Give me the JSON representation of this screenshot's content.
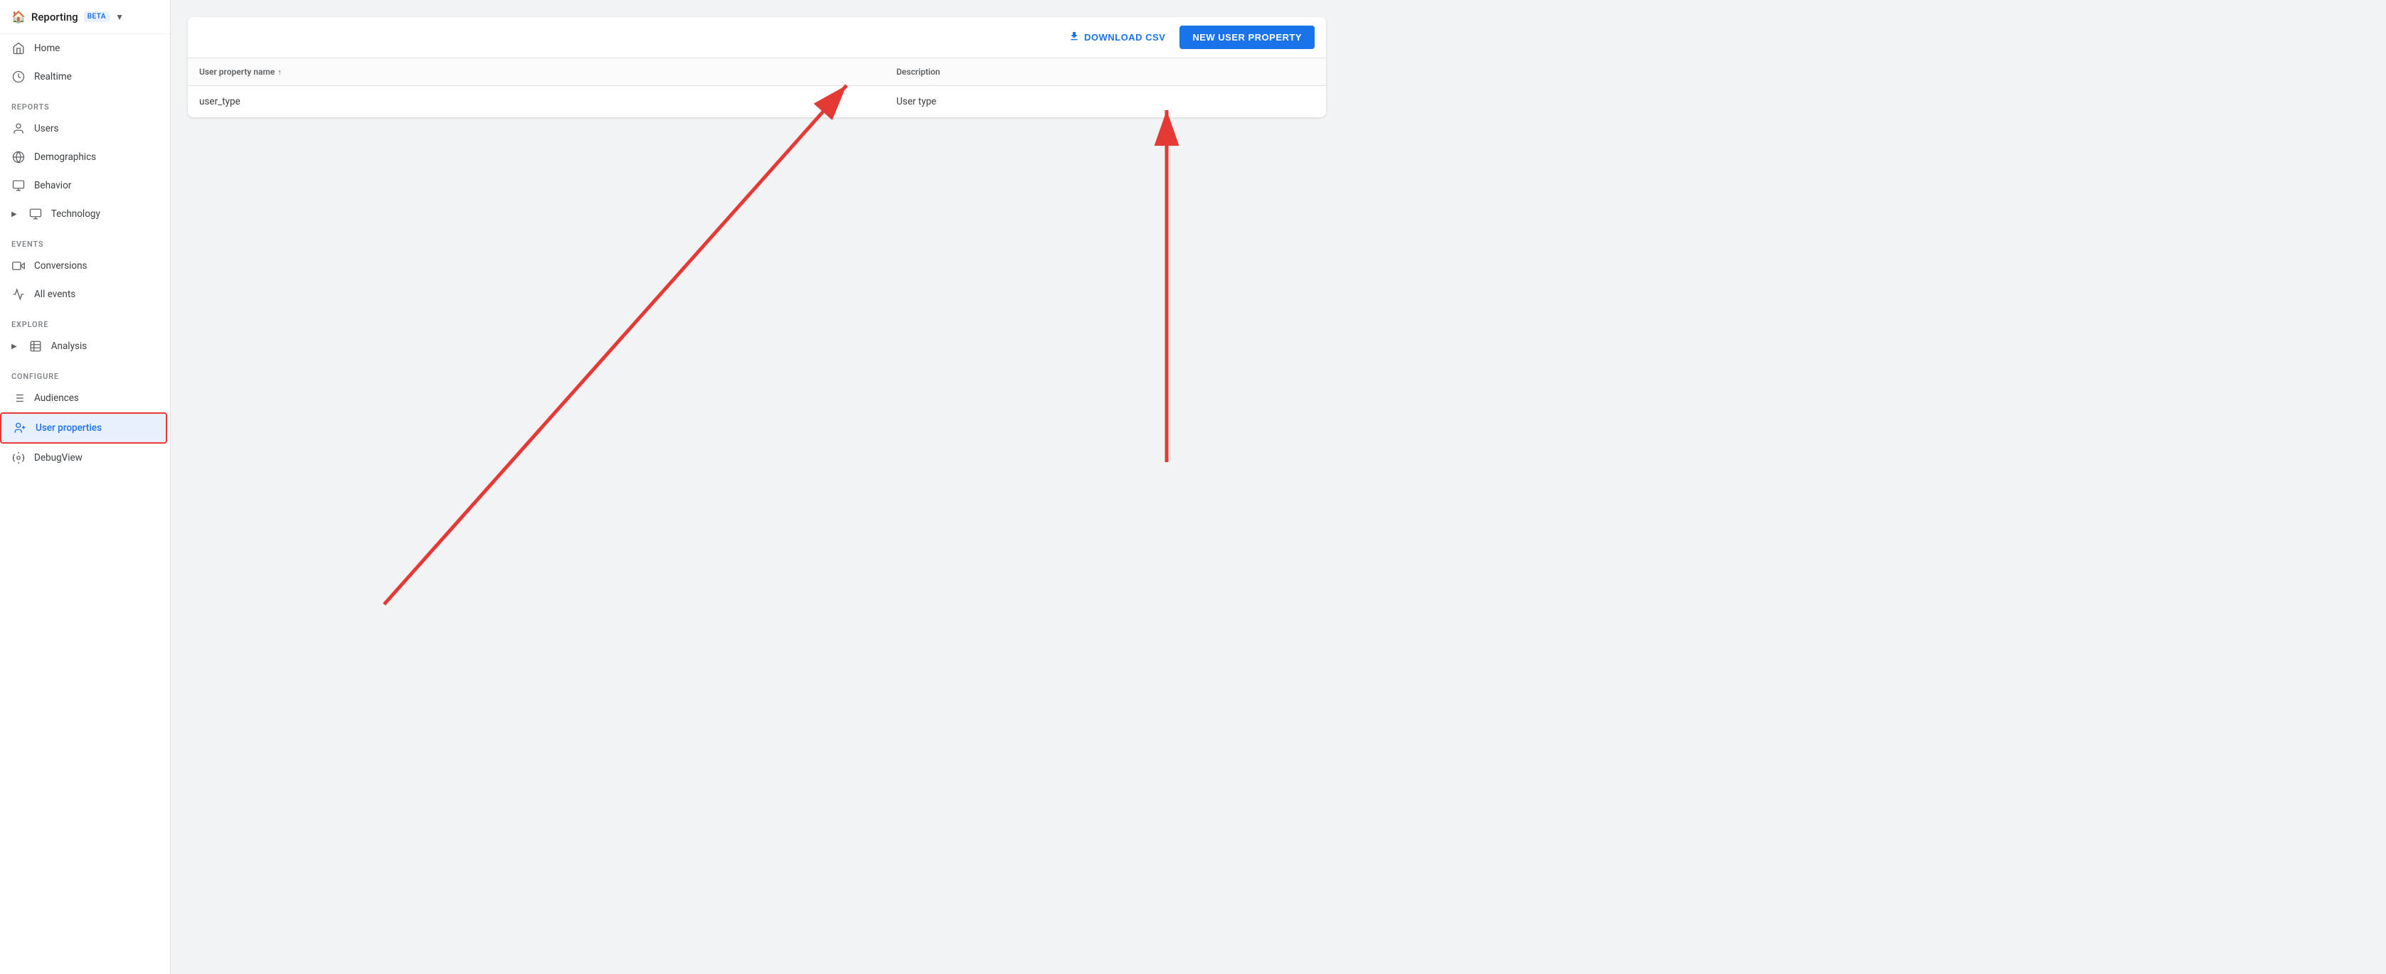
{
  "header": {
    "title": "Reporting",
    "badge": "BETA",
    "chevron": "▼"
  },
  "sidebar": {
    "reports_section": "REPORTS",
    "events_section": "EVENTS",
    "explore_section": "EXPLORE",
    "configure_section": "CONFIGURE",
    "items": {
      "home": "Home",
      "realtime": "Realtime",
      "users": "Users",
      "demographics": "Demographics",
      "behavior": "Behavior",
      "technology": "Technology",
      "conversions": "Conversions",
      "all_events": "All events",
      "analysis": "Analysis",
      "audiences": "Audiences",
      "user_properties": "User properties",
      "debugview": "DebugView"
    }
  },
  "toolbar": {
    "download_csv": "DOWNLOAD CSV",
    "new_user_property": "NEW USER PROPERTY"
  },
  "table": {
    "columns": [
      {
        "key": "name",
        "label": "User property name",
        "sortable": true
      },
      {
        "key": "description",
        "label": "Description",
        "sortable": false
      }
    ],
    "rows": [
      {
        "name": "user_type",
        "description": "User type"
      }
    ]
  }
}
